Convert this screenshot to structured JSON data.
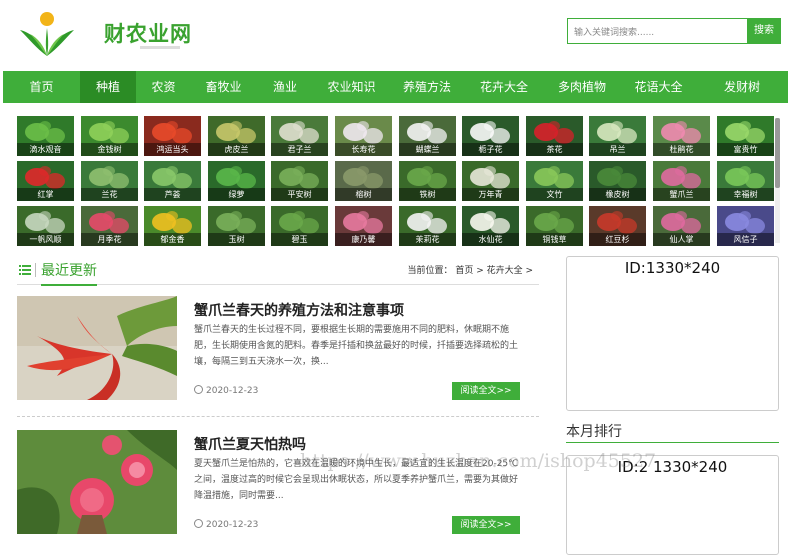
{
  "header": {
    "logo_text": "财农业网",
    "search_placeholder": "输入关键词搜索......",
    "search_button": "搜索"
  },
  "nav": {
    "items": [
      {
        "label": "首页",
        "active": false
      },
      {
        "label": "种植",
        "active": true
      },
      {
        "label": "农资",
        "active": false
      },
      {
        "label": "畜牧业",
        "active": false
      },
      {
        "label": "渔业",
        "active": false
      },
      {
        "label": "农业知识",
        "active": false
      },
      {
        "label": "养殖方法",
        "active": false
      },
      {
        "label": "花卉大全",
        "active": false
      },
      {
        "label": "多肉植物",
        "active": false
      },
      {
        "label": "花语大全",
        "active": false
      },
      {
        "label": "发财树",
        "active": false
      }
    ]
  },
  "plants": [
    [
      "滴水观音",
      "金钱树",
      "鸿运当头",
      "虎皮兰",
      "君子兰",
      "长寿花",
      "蝴蝶兰",
      "栀子花",
      "茶花",
      "吊兰",
      "杜鹃花",
      "富贵竹"
    ],
    [
      "红掌",
      "兰花",
      "芦荟",
      "绿萝",
      "平安树",
      "榕树",
      "铁树",
      "万年青",
      "文竹",
      "橡皮树",
      "蟹爪兰",
      "幸福树"
    ],
    [
      "一帆风顺",
      "月季花",
      "郁金香",
      "玉树",
      "碧玉",
      "康乃馨",
      "茉莉花",
      "水仙花",
      "铜钱草",
      "红豆杉",
      "仙人掌",
      "风信子"
    ]
  ],
  "section": {
    "title": "最近更新",
    "breadcrumb": "当前位置： 首页 > 花卉大全 >"
  },
  "articles": [
    {
      "title": "蟹爪兰春天的养殖方法和注意事项",
      "desc": "蟹爪兰春天的生长过程不同，要根据生长期的需要施用不同的肥料，休眠期不施肥，生长期使用含氮的肥料。春季是扦插和换盆最好的时候，扦插要选择疏松的土壤，每隔三到五天浇水一次，换...",
      "date": "2020-12-23",
      "more": "阅读全文>>"
    },
    {
      "title": "蟹爪兰夏天怕热吗",
      "desc": "夏天蟹爪兰是怕热的，它喜欢在温暖的环境中生长，最适宜的生长温度在20-25℃之间，温度过高的时候它会呈现出休眠状态，所以夏季养护蟹爪兰，需要为其做好降温措施，同时需要...",
      "date": "2020-12-23",
      "more": "阅读全文>>"
    }
  ],
  "sidebar": {
    "ad1": "ID:1330*240",
    "rank_title": "本月排行",
    "ad2": "ID:2 1330*240"
  },
  "watermark": "https://www.huzhan.com/ishop45527",
  "colors": {
    "brand_green": "#3fae3a",
    "nav_active": "#2b8c25"
  }
}
